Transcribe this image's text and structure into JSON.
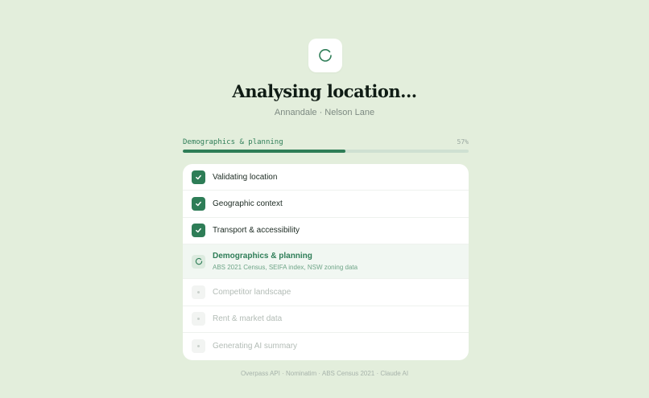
{
  "header": {
    "title": "Analysing location...",
    "subtitle": "Annandale · Nelson Lane"
  },
  "progress": {
    "label": "Demographics & planning",
    "percent_label": "57%",
    "fraction": 0.57
  },
  "steps": [
    {
      "label": "Validating location",
      "status": "done",
      "icon": "check-icon"
    },
    {
      "label": "Geographic context",
      "status": "done",
      "icon": "check-icon"
    },
    {
      "label": "Transport & accessibility",
      "status": "done",
      "icon": "check-icon"
    },
    {
      "label": "Demographics & planning",
      "description": "ABS 2021 Census, SEIFA index, NSW zoning data",
      "status": "active",
      "icon": "spinner-icon"
    },
    {
      "label": "Competitor landscape",
      "status": "pending",
      "icon": "dot-icon"
    },
    {
      "label": "Rent & market data",
      "status": "pending",
      "icon": "dot-icon"
    },
    {
      "label": "Generating AI summary",
      "status": "pending",
      "icon": "dot-icon"
    }
  ],
  "footer": {
    "text": "Overpass API · Nominatim · ABS Census 2021 · Claude AI"
  },
  "colors": {
    "background": "#e3eedc",
    "accent": "#2e7d57",
    "card": "#ffffff"
  }
}
